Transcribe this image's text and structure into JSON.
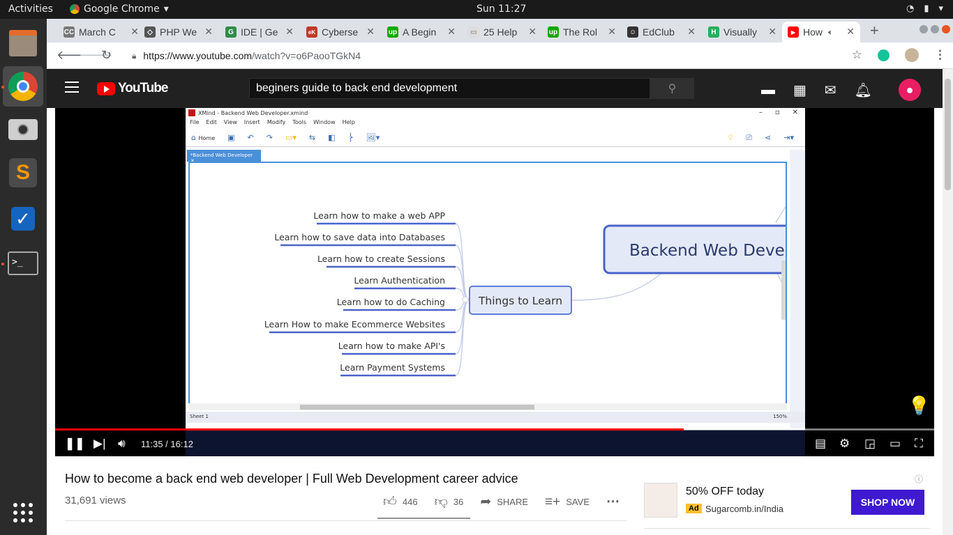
{
  "os": {
    "activities": "Activities",
    "app_name": "Google Chrome",
    "clock": "Sun 11:27"
  },
  "chrome": {
    "tabs": [
      {
        "title": "March C",
        "fav": "CC",
        "fav_color": "#777777"
      },
      {
        "title": "PHP We",
        "fav": "◇",
        "fav_color": "#555555"
      },
      {
        "title": "IDE | Ge",
        "fav": "G",
        "fav_color": "#2f8d46"
      },
      {
        "title": "Cyberse",
        "fav": "eK",
        "fav_color": "#c0392b"
      },
      {
        "title": "A Begin",
        "fav": "up",
        "fav_color": "#14a800"
      },
      {
        "title": "25 Help",
        "fav": "▭",
        "fav_color": "#bbbbbb"
      },
      {
        "title": "The Rol",
        "fav": "up",
        "fav_color": "#14a800"
      },
      {
        "title": "EdClub",
        "fav": "☺",
        "fav_color": "#333333"
      },
      {
        "title": "Visually",
        "fav": "H",
        "fav_color": "#27ae60"
      },
      {
        "title": "How",
        "fav": "▶",
        "fav_color": "#ff0000"
      }
    ],
    "url_host": "https://www.youtube.com",
    "url_path": "/watch?v=o6PaooTGkN4"
  },
  "youtube": {
    "logo": "YouTube",
    "search_query": "beginers guide to back end development",
    "video_title": "How to become a back end web developer | Full Web Development career advice",
    "views": "31,691 views",
    "likes": "446",
    "dislikes": "36",
    "share_label": "SHARE",
    "save_label": "SAVE",
    "time": "11:35 / 16:12",
    "progress_fraction": 0.715,
    "brand_color": "#ff0000"
  },
  "xmind": {
    "window_title": "XMind - Backend Web Developer.xmind",
    "menu": [
      "File",
      "Edit",
      "View",
      "Insert",
      "Modify",
      "Tools",
      "Window",
      "Help"
    ],
    "home_label": "Home",
    "doc_tab": "*Backend Web Developer",
    "central_topic": "Backend Web Deve",
    "main_topic": "Things to Learn",
    "subtopics": [
      "Learn how to make a web APP",
      "Learn how to save data into Databases",
      "Learn how to create Sessions",
      "Learn Authentication",
      "Learn how to do Caching",
      "Learn How to make Ecommerce Websites",
      "Learn how to make API's",
      "Learn Payment Systems"
    ],
    "sheet_label": "Sheet 1",
    "zoom": "150%"
  },
  "ad": {
    "headline": "50% OFF today",
    "badge": "Ad",
    "domain": "Sugarcomb.in/India",
    "cta": "SHOP NOW",
    "cta_color": "#3f1ad1"
  }
}
